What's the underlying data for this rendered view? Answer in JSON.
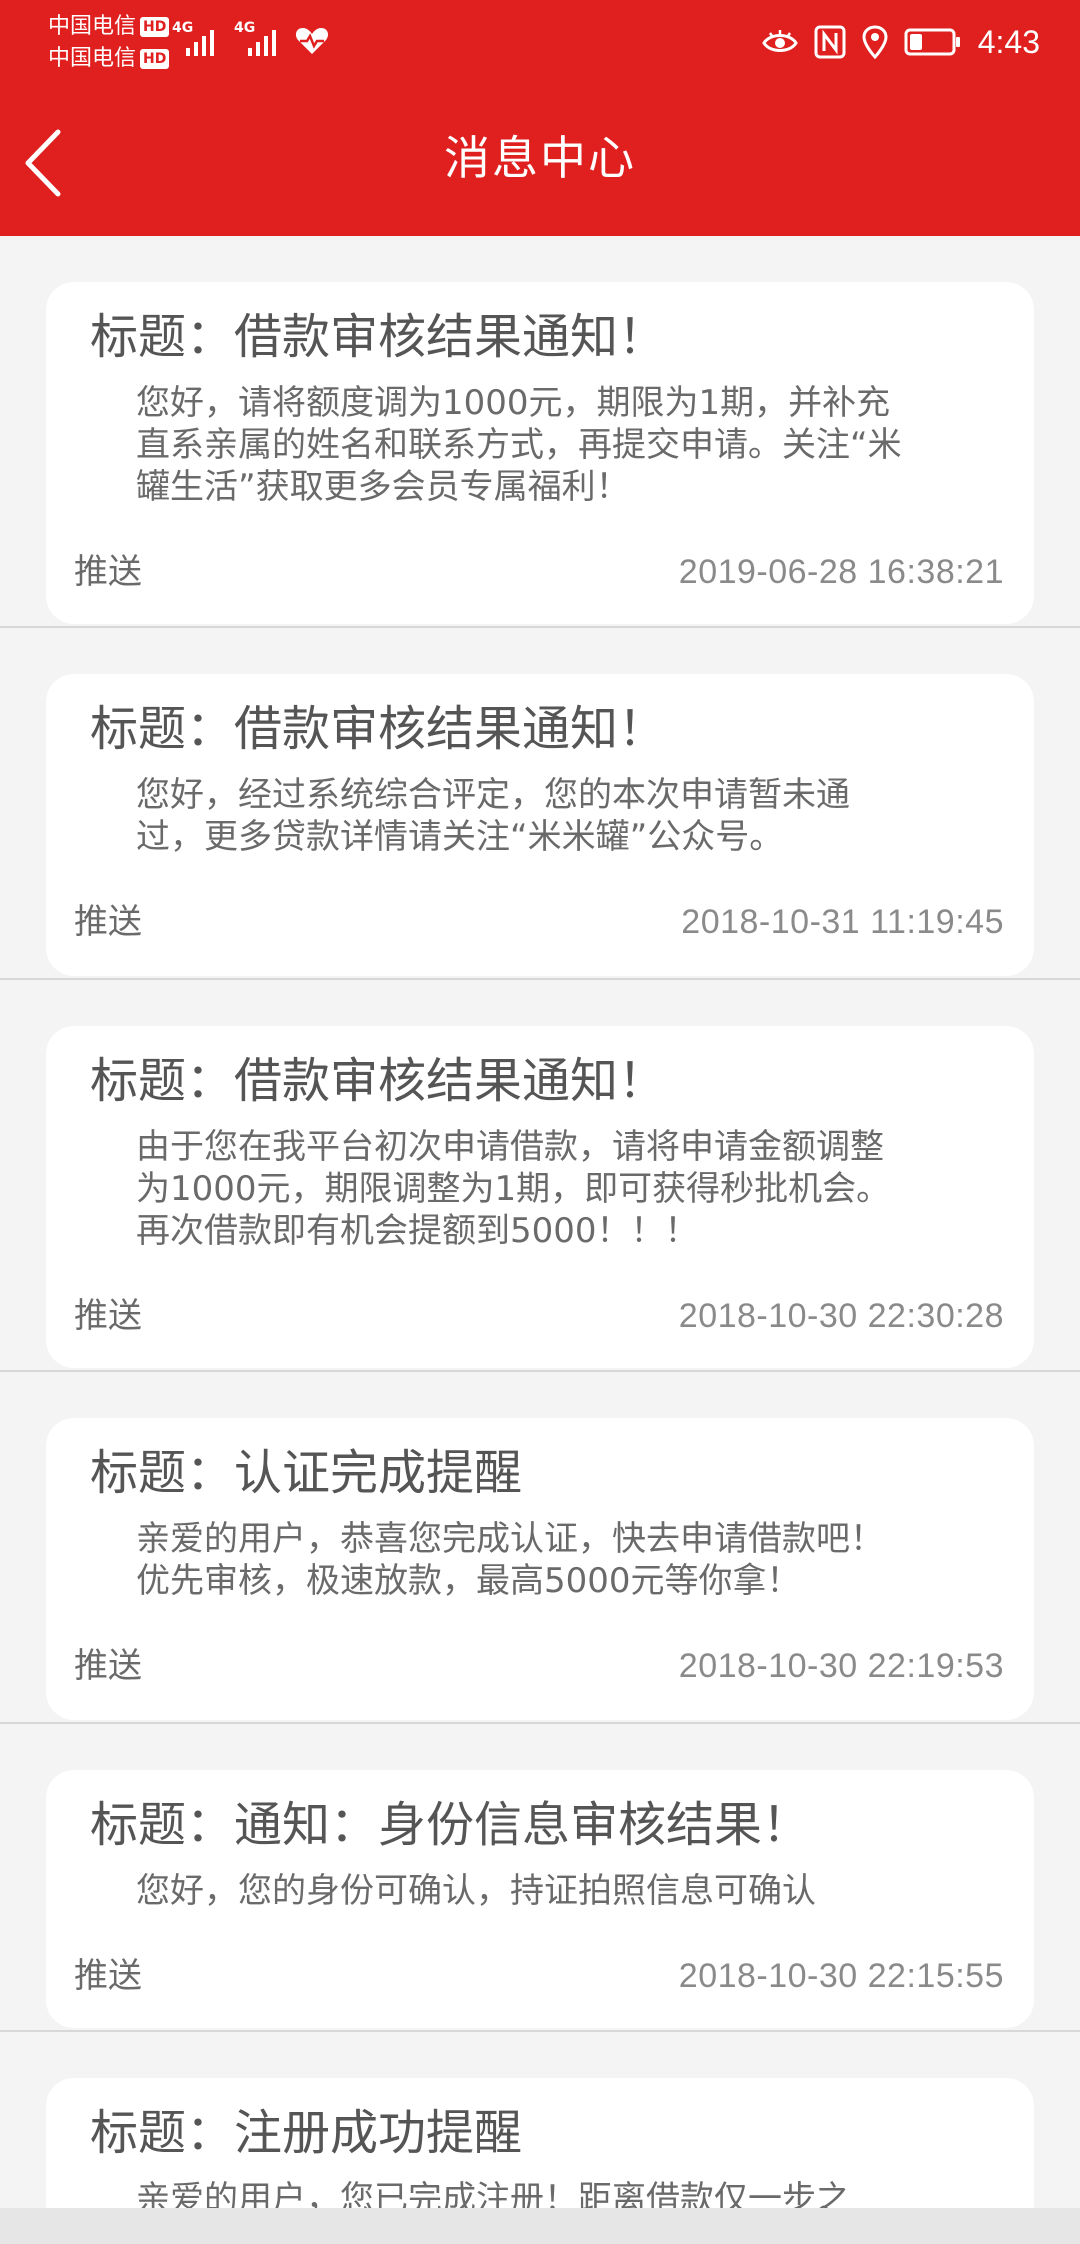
{
  "status_bar": {
    "carrier_1": "中国电信",
    "carrier_2": "中国电信",
    "hd_label": "HD",
    "network_1": "4G",
    "network_2": "4G",
    "time": "4:43",
    "icons": [
      "eye-icon",
      "nfc-icon",
      "location-icon",
      "battery-icon"
    ],
    "accent_color": "#e01f1f"
  },
  "nav": {
    "title": "消息中心",
    "back_icon": "chevron-left-icon"
  },
  "messages": [
    {
      "title": "标题：借款审核结果通知！",
      "body_lines": [
        "您好，请将额度调为1000元，期限为1期，并补充",
        "直系亲属的姓名和联系方式，再提交申请。关注“米",
        "罐生活”获取更多会员专属福利！"
      ],
      "footer_label": "推送",
      "time": "2019-06-28 16:38:21"
    },
    {
      "title": "标题：借款审核结果通知！",
      "body_lines": [
        "您好，经过系统综合评定，您的本次申请暂未通",
        "过，更多贷款详情请关注“米米罐”公众号。"
      ],
      "footer_label": "推送",
      "time": "2018-10-31 11:19:45"
    },
    {
      "title": "标题：借款审核结果通知！",
      "body_lines": [
        "由于您在我平台初次申请借款，请将申请金额调整",
        "为1000元，期限调整为1期，即可获得秒批机会。",
        "再次借款即有机会提额到5000！！！"
      ],
      "footer_label": "推送",
      "time": "2018-10-30 22:30:28"
    },
    {
      "title": "标题：认证完成提醒",
      "body_lines": [
        "亲爱的用户，恭喜您完成认证，快去申请借款吧！",
        "优先审核，极速放款，最高5000元等你拿！"
      ],
      "footer_label": "推送",
      "time": "2018-10-30 22:19:53"
    },
    {
      "title": "标题：通知：身份信息审核结果！",
      "body_lines": [
        "您好，您的身份可确认，持证拍照信息可确认"
      ],
      "footer_label": "推送",
      "time": "2018-10-30 22:15:55"
    },
    {
      "title": "标题：注册成功提醒",
      "body_lines": [
        "亲爱的用户，您已完成注册！距离借款仅一步之"
      ],
      "footer_label": "",
      "time": ""
    }
  ]
}
